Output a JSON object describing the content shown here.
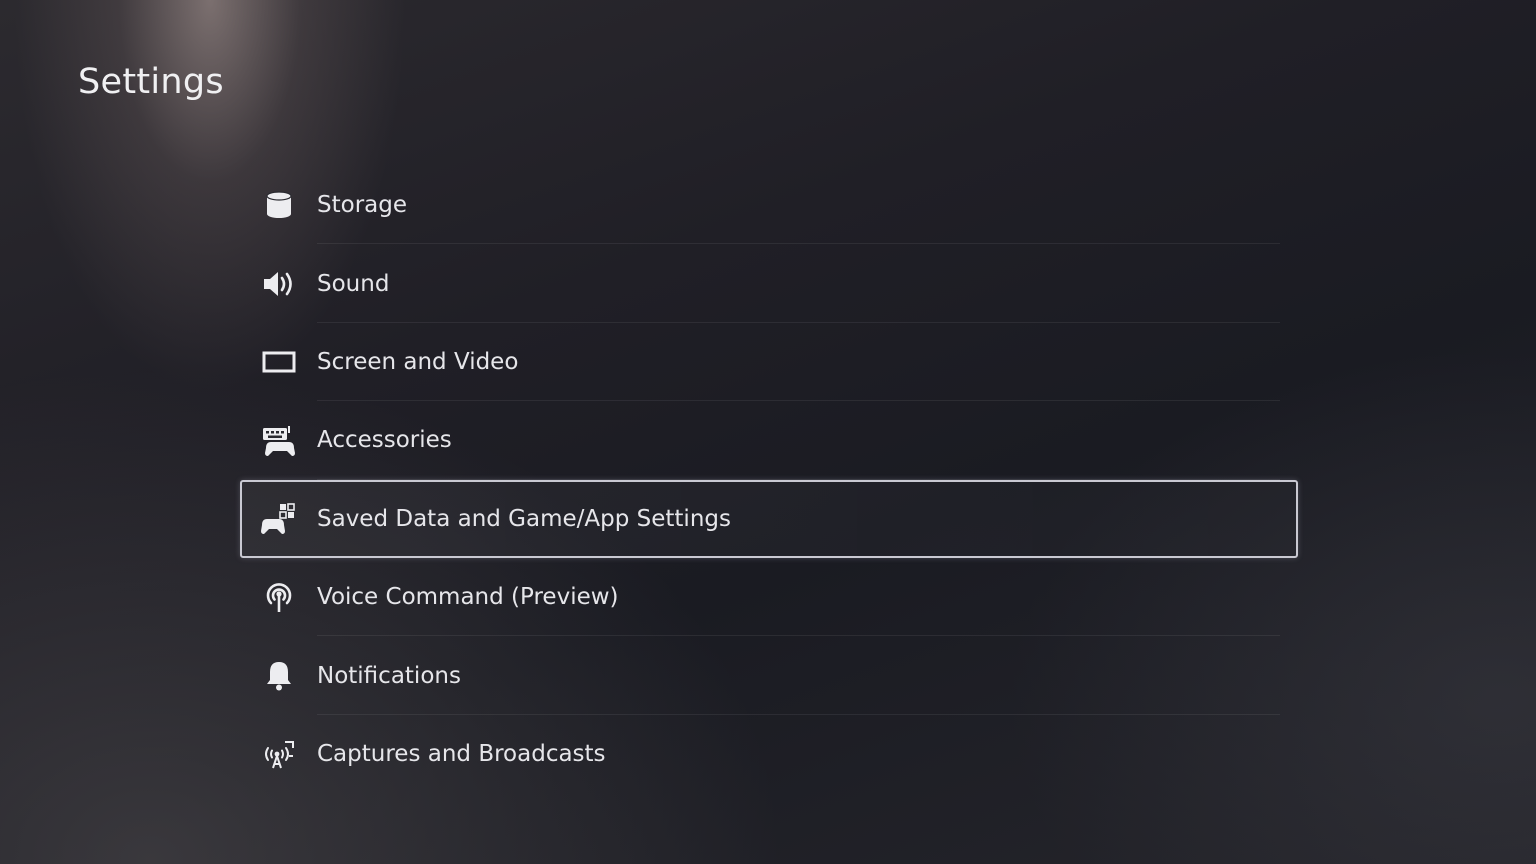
{
  "header": {
    "title": "Settings"
  },
  "menu": {
    "items": [
      {
        "label": "Storage",
        "icon": "storage-icon"
      },
      {
        "label": "Sound",
        "icon": "speaker-icon"
      },
      {
        "label": "Screen and Video",
        "icon": "screen-icon"
      },
      {
        "label": "Accessories",
        "icon": "keyboard-controller-icon"
      },
      {
        "label": "Saved Data and Game/App Settings",
        "icon": "controller-data-icon",
        "selected": true
      },
      {
        "label": "Voice Command (Preview)",
        "icon": "microphone-icon"
      },
      {
        "label": "Notifications",
        "icon": "bell-icon"
      },
      {
        "label": "Captures and Broadcasts",
        "icon": "broadcast-icon"
      }
    ]
  },
  "colors": {
    "text": "#e6e6ea",
    "selection_border": "#c9c9d2",
    "background": "#1c1c22"
  }
}
